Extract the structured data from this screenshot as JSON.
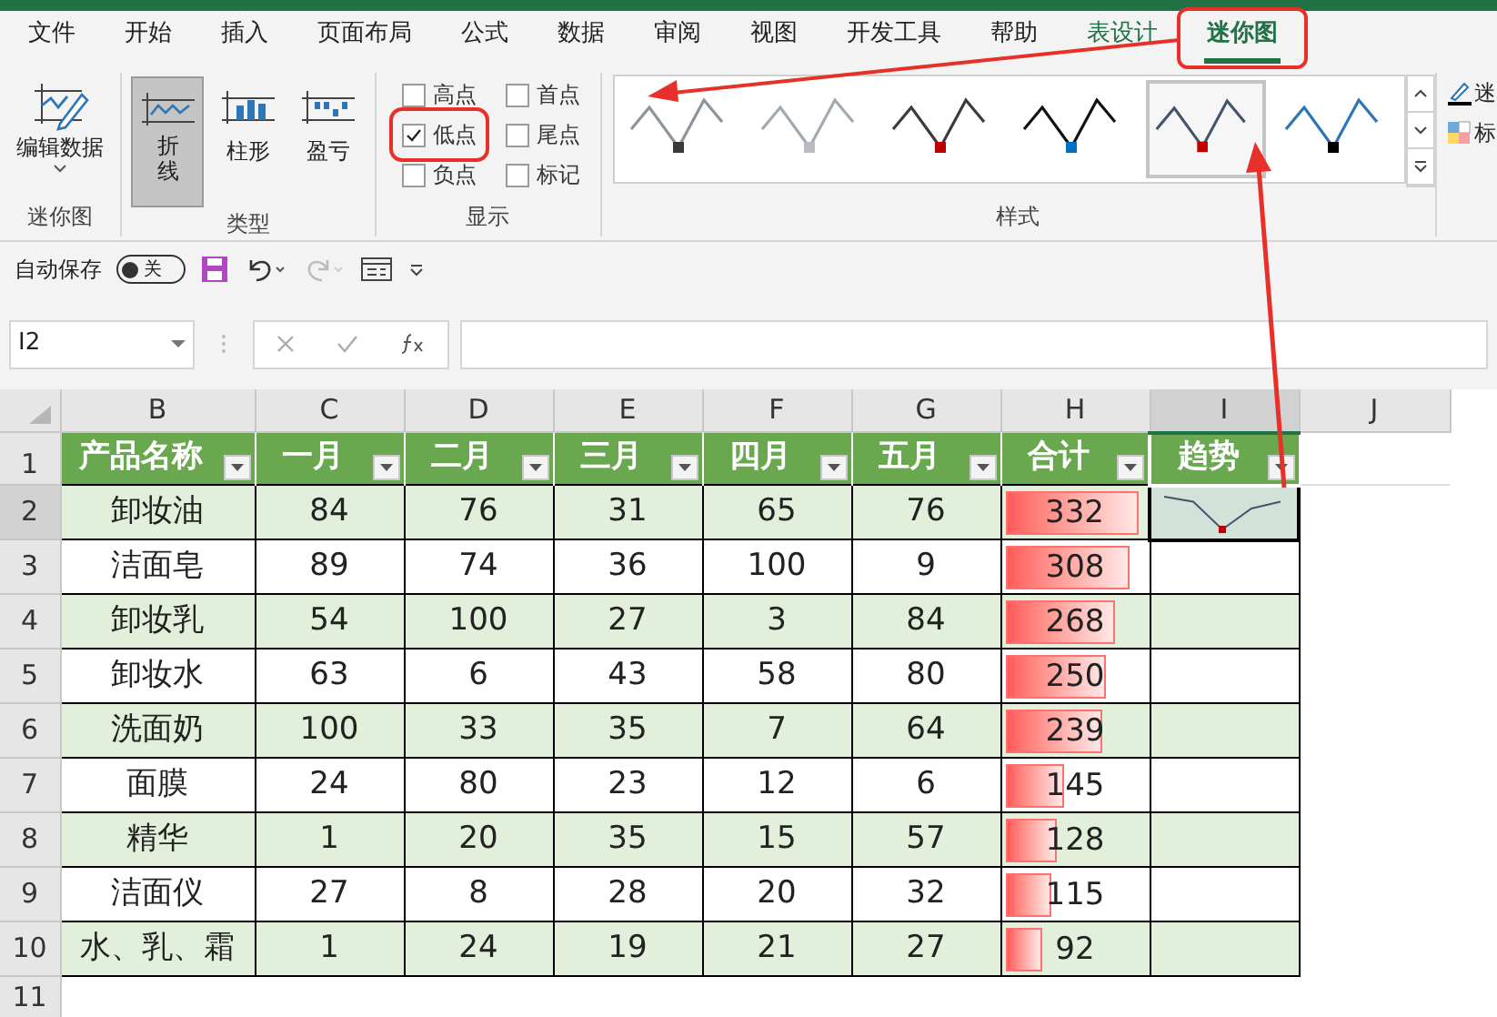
{
  "menu_tabs": [
    {
      "label": "文件",
      "selected": false,
      "contextual": false
    },
    {
      "label": "开始",
      "selected": false,
      "contextual": false
    },
    {
      "label": "插入",
      "selected": false,
      "contextual": false
    },
    {
      "label": "页面布局",
      "selected": false,
      "contextual": false
    },
    {
      "label": "公式",
      "selected": false,
      "contextual": false
    },
    {
      "label": "数据",
      "selected": false,
      "contextual": false
    },
    {
      "label": "审阅",
      "selected": false,
      "contextual": false
    },
    {
      "label": "视图",
      "selected": false,
      "contextual": false
    },
    {
      "label": "开发工具",
      "selected": false,
      "contextual": false
    },
    {
      "label": "帮助",
      "selected": false,
      "contextual": false
    },
    {
      "label": "表设计",
      "selected": false,
      "contextual": true
    },
    {
      "label": "迷你图",
      "selected": true,
      "contextual": true,
      "highlighted": true
    }
  ],
  "ribbon": {
    "sparkline_group": {
      "edit_label": "编辑数据",
      "title": "迷你图"
    },
    "type_group": {
      "title": "类型",
      "items": [
        {
          "label": "折线",
          "kind": "line",
          "selected": true
        },
        {
          "label": "柱形",
          "kind": "column",
          "selected": false
        },
        {
          "label": "盈亏",
          "kind": "winloss",
          "selected": false
        }
      ]
    },
    "show_group": {
      "title": "显示",
      "items": [
        {
          "label": "高点",
          "checked": false
        },
        {
          "label": "低点",
          "checked": true,
          "highlighted": true
        },
        {
          "label": "负点",
          "checked": false
        },
        {
          "label": "首点",
          "checked": false
        },
        {
          "label": "尾点",
          "checked": false
        },
        {
          "label": "标记",
          "checked": false
        }
      ]
    },
    "style_group": {
      "title": "样式",
      "styles": [
        {
          "color": "#3a3a3a",
          "selected": false
        },
        {
          "color": "#b8bcc2",
          "selected": false
        },
        {
          "color": "#c00000",
          "selected": false
        },
        {
          "color": "#0070c0",
          "selected": false
        },
        {
          "color": "#c00000",
          "selected": true
        },
        {
          "color": "#000000",
          "selected": false
        }
      ]
    },
    "side_labels": [
      "迷",
      "标"
    ]
  },
  "quick_access": {
    "autosave_label": "自动保存",
    "autosave_state": "关",
    "autosave_on": false
  },
  "formula_bar": {
    "name_box": "I2"
  },
  "sheet": {
    "column_letters": [
      "B",
      "C",
      "D",
      "E",
      "F",
      "G",
      "H",
      "I",
      "J"
    ],
    "header_row": {
      "row_number": "1",
      "cells": [
        "产品名称",
        "一月",
        "二月",
        "三月",
        "四月",
        "五月",
        "合计",
        "趋势"
      ]
    },
    "rows": [
      {
        "row_number": "2",
        "cells": [
          "卸妆油",
          "84",
          "76",
          "31",
          "65",
          "76"
        ],
        "total": "332",
        "level": 0.96,
        "sparkline": true
      },
      {
        "row_number": "3",
        "cells": [
          "洁面皂",
          "89",
          "74",
          "36",
          "100",
          "9"
        ],
        "total": "308",
        "level": 0.89,
        "sparkline": false
      },
      {
        "row_number": "4",
        "cells": [
          "卸妆乳",
          "54",
          "100",
          "27",
          "3",
          "84"
        ],
        "total": "268",
        "level": 0.78,
        "sparkline": false
      },
      {
        "row_number": "5",
        "cells": [
          "卸妆水",
          "63",
          "6",
          "43",
          "58",
          "80"
        ],
        "total": "250",
        "level": 0.72,
        "sparkline": false
      },
      {
        "row_number": "6",
        "cells": [
          "洗面奶",
          "100",
          "33",
          "35",
          "7",
          "64"
        ],
        "total": "239",
        "level": 0.69,
        "sparkline": false
      },
      {
        "row_number": "7",
        "cells": [
          "面膜",
          "24",
          "80",
          "23",
          "12",
          "6"
        ],
        "total": "145",
        "level": 0.42,
        "sparkline": false
      },
      {
        "row_number": "8",
        "cells": [
          "精华",
          "1",
          "20",
          "35",
          "15",
          "57"
        ],
        "total": "128",
        "level": 0.37,
        "sparkline": false
      },
      {
        "row_number": "9",
        "cells": [
          "洁面仪",
          "27",
          "8",
          "28",
          "20",
          "32"
        ],
        "total": "115",
        "level": 0.33,
        "sparkline": false
      },
      {
        "row_number": "10",
        "cells": [
          "水、乳、霜",
          "1",
          "24",
          "19",
          "21",
          "27"
        ],
        "total": "92",
        "level": 0.27,
        "sparkline": false
      }
    ],
    "empty_row_numbers": [
      "11"
    ]
  }
}
